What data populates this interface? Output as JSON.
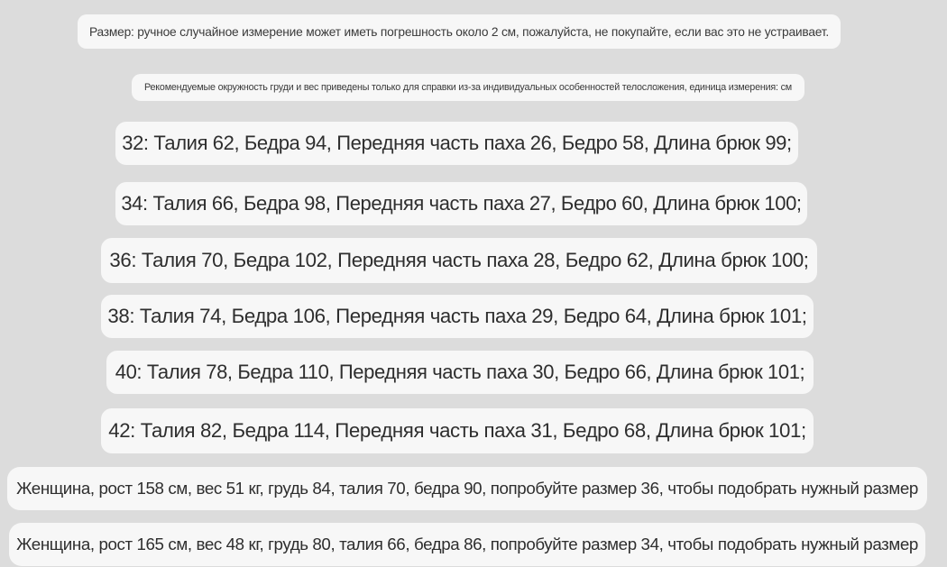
{
  "notes": {
    "measurement": "Размер: ручное случайное измерение может иметь погрешность около 2 см, пожалуйста, не покупайте, если вас это не устраивает.",
    "reference": "Рекомендуемые окружность груди и вес приведены только для справки из-за индивидуальных особенностей телосложения, единица измерения: см"
  },
  "sizes": [
    "32: Талия 62, Бедра 94, Передняя часть паха 26, Бедро 58, Длина брюк 99;",
    "34: Талия 66, Бедра 98, Передняя часть паха 27, Бедро 60, Длина брюк 100;",
    "36: Талия 70, Бедра 102, Передняя часть паха 28, Бедро 62, Длина брюк 100;",
    "38: Талия 74, Бедра 106, Передняя часть паха 29, Бедро 64, Длина брюк 101;",
    "40: Талия 78, Бедра 110, Передняя часть паха 30, Бедро 66, Длина брюк 101;",
    "42: Талия 82, Бедра 114, Передняя часть паха 31, Бедро 68, Длина брюк 101;"
  ],
  "examples": [
    "Женщина, рост 158 см, вес 51 кг, грудь 84, талия 70, бедра 90, попробуйте размер 36, чтобы подобрать нужный размер",
    "Женщина, рост 165 см, вес 48 кг, грудь 80, талия 66, бедра 86, попробуйте размер 34, чтобы подобрать нужный размер"
  ]
}
